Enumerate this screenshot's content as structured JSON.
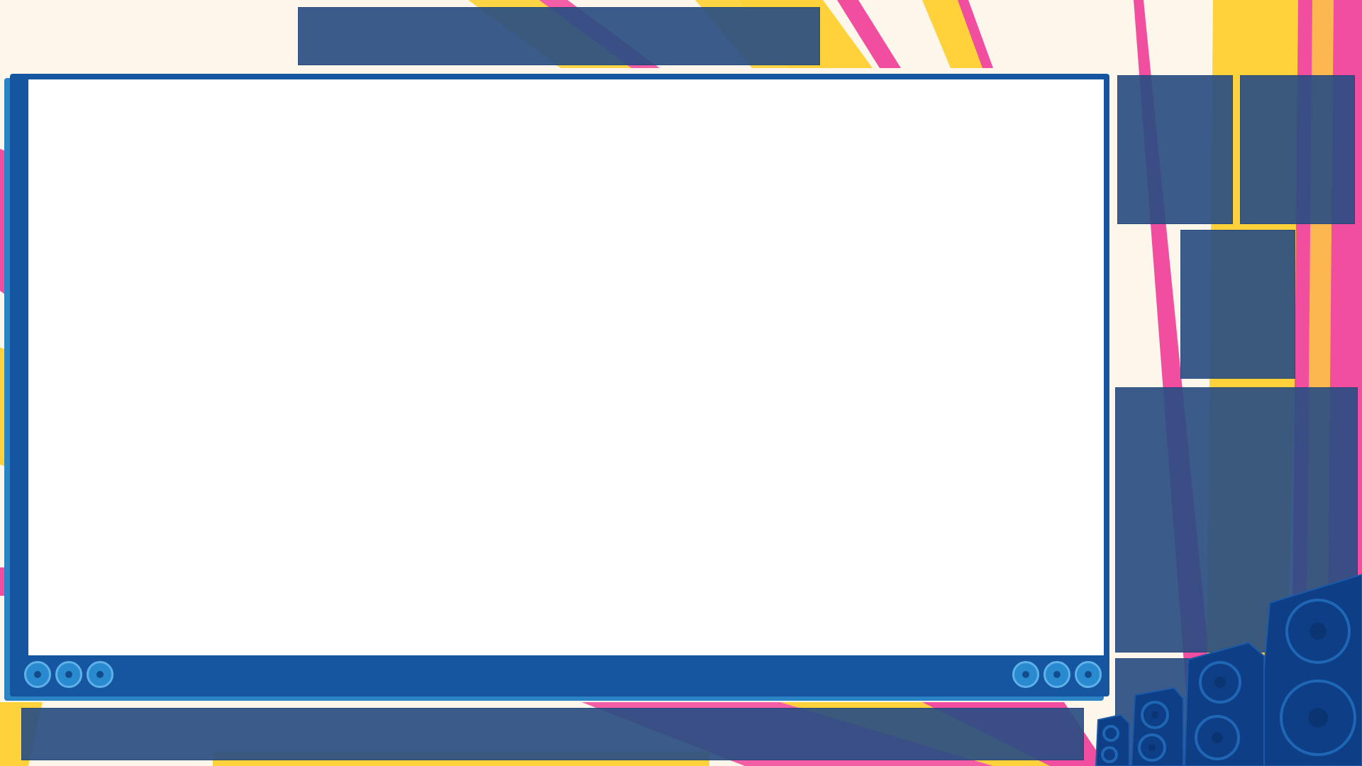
{
  "colors": {
    "background": "#fdf6ea",
    "frame_blue": "#1656a0",
    "frame_edge": "#2a83c4",
    "panel_navy": "#2a4e82",
    "stripe_yellow": "#ffd23c",
    "stripe_pink": "#f24ea0",
    "speaker_light": "#2a8ad0"
  },
  "speakers": {
    "left_count": 3,
    "right_count": 3
  }
}
